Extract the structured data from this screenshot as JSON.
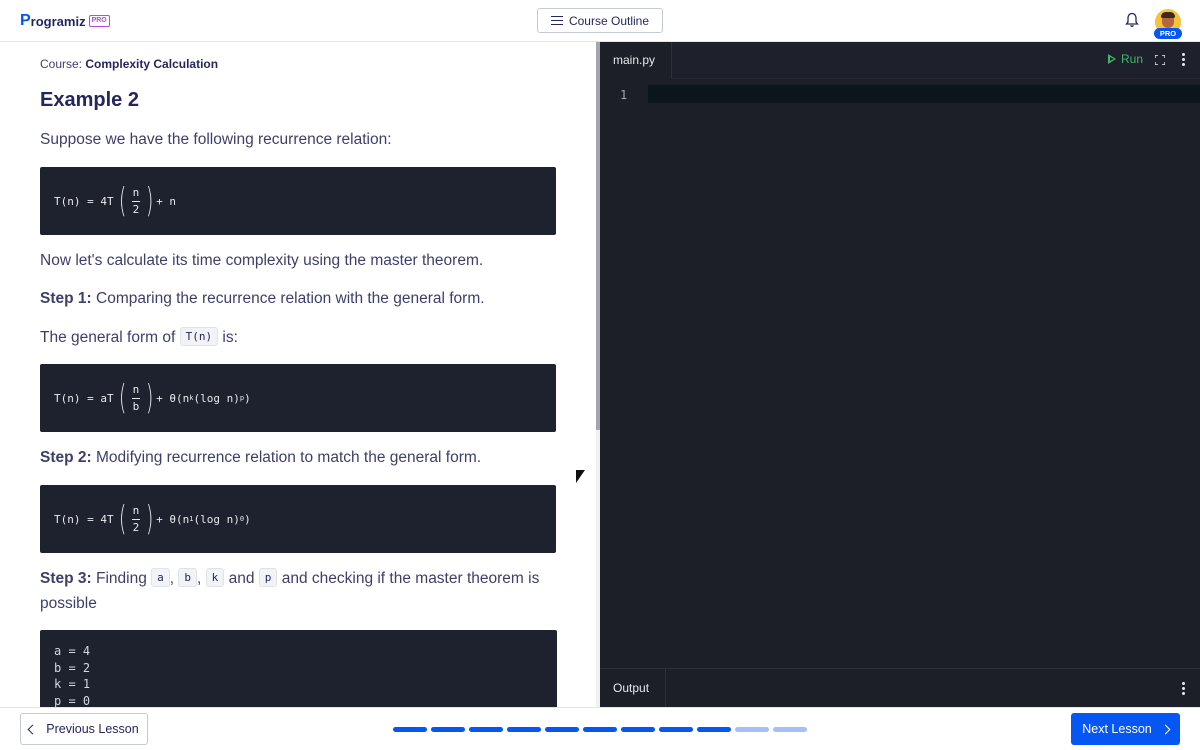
{
  "header": {
    "logo_text": "rogramiz",
    "logo_initial": "P",
    "logo_badge": "PRO",
    "course_outline_label": "Course Outline",
    "avatar_badge": "PRO"
  },
  "lesson": {
    "breadcrumb_prefix": "Course:",
    "breadcrumb_course": "Complexity Calculation",
    "title": "Example 2",
    "intro": "Suppose we have the following recurrence relation:",
    "eq1": {
      "lhs": "T(n) = 4T",
      "num": "n",
      "den": "2",
      "rhs": "+ n"
    },
    "calc_text": "Now let's calculate its time complexity using the master theorem.",
    "step1_label": "Step 1:",
    "step1_text": "Comparing the recurrence relation with the general form.",
    "general_form_pre": "The general form of",
    "general_form_code": "T(n)",
    "general_form_post": "is:",
    "eq2": {
      "lhs": "T(n) = aT",
      "num": "n",
      "den": "b",
      "rhs_pre": "+ θ(n",
      "rhs_sup": "k",
      "rhs_mid": "(log n)",
      "rhs_sup2": "p",
      "rhs_end": ")"
    },
    "step2_label": "Step 2:",
    "step2_text": "Modifying recurrence relation to match the general form.",
    "eq3": {
      "lhs": "T(n) = 4T",
      "num": "n",
      "den": "2",
      "rhs_pre": "+ θ(n",
      "rhs_sup": "1",
      "rhs_mid": "(log n)",
      "rhs_sup2": "0",
      "rhs_end": ")"
    },
    "step3_label": "Step 3:",
    "step3_text_pre": "Finding",
    "step3_codes": [
      "a",
      "b",
      "k",
      "p"
    ],
    "step3_and": "and",
    "step3_text_post": "and checking if the master theorem is",
    "step3_text_line2": "possible",
    "code_block": "a = 4\nb = 2\nk = 1\np = 0"
  },
  "editor": {
    "file_tab": "main.py",
    "run_label": "Run",
    "line_number": "1",
    "output_tab": "Output"
  },
  "footer": {
    "prev_label": "Previous Lesson",
    "next_label": "Next Lesson",
    "progress_completed": 9,
    "progress_total": 11
  },
  "colors": {
    "accent": "#0556f3",
    "run_green": "#3fb66a",
    "editor_bg": "#1c1f28",
    "pro_purple": "#b24ce4"
  }
}
